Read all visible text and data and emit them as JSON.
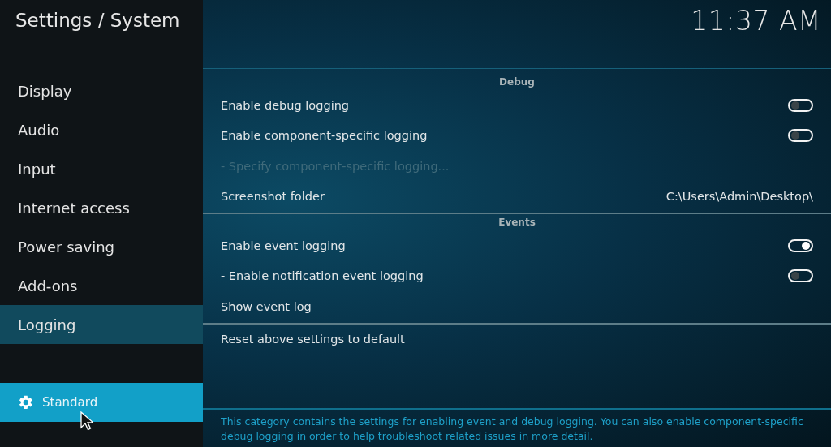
{
  "sidebar": {
    "title": "Settings / System",
    "items": [
      {
        "label": "Display",
        "selected": false
      },
      {
        "label": "Audio",
        "selected": false
      },
      {
        "label": "Input",
        "selected": false
      },
      {
        "label": "Internet access",
        "selected": false
      },
      {
        "label": "Power saving",
        "selected": false
      },
      {
        "label": "Add-ons",
        "selected": false
      },
      {
        "label": "Logging",
        "selected": true
      }
    ],
    "level_button": {
      "label": "Standard"
    }
  },
  "clock": "11:37 AM",
  "sections": [
    {
      "title": "Debug",
      "items": [
        {
          "kind": "toggle",
          "label": "Enable debug logging",
          "on": false
        },
        {
          "kind": "toggle",
          "label": "Enable component-specific logging",
          "on": false
        },
        {
          "kind": "action",
          "label": "- Specify component-specific logging...",
          "disabled": true
        },
        {
          "kind": "value",
          "label": "Screenshot folder",
          "value": "C:\\Users\\Admin\\Desktop\\"
        }
      ]
    },
    {
      "title": "Events",
      "items": [
        {
          "kind": "toggle",
          "label": "Enable event logging",
          "on": true
        },
        {
          "kind": "toggle",
          "label": "- Enable notification event logging",
          "on": false
        },
        {
          "kind": "action",
          "label": "Show event log",
          "disabled": false
        }
      ]
    },
    {
      "items": [
        {
          "kind": "action",
          "label": "Reset above settings to default",
          "disabled": false
        }
      ]
    }
  ],
  "description": "This category contains the settings for enabling event and debug logging. You can also enable component-specific debug logging in order to help troubleshoot related issues in more detail."
}
